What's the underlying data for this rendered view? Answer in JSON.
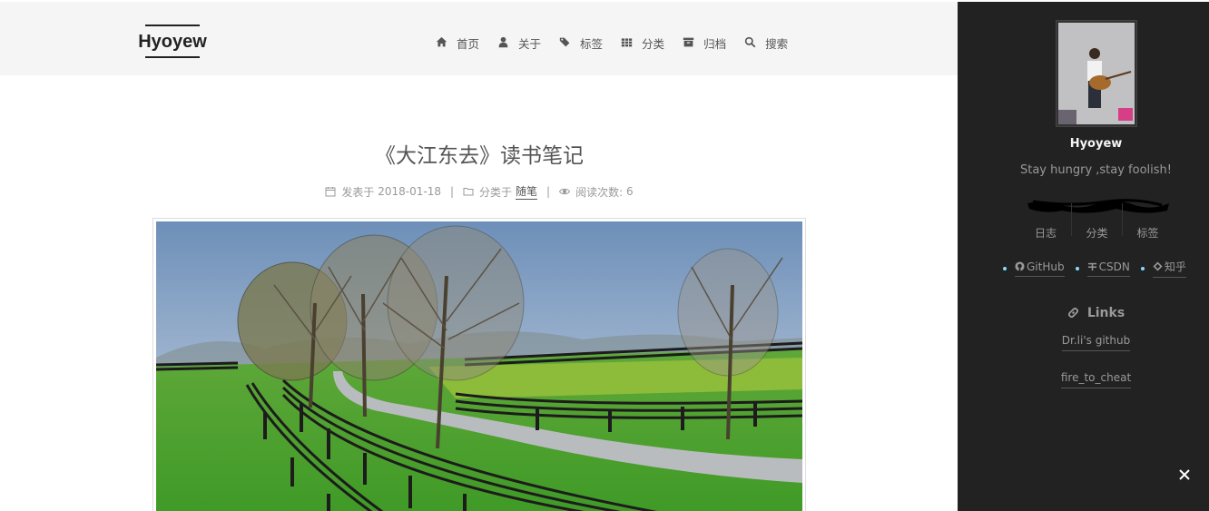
{
  "header": {
    "brand": "Hyoyew",
    "menu": [
      {
        "label": "首页",
        "icon": "home-icon"
      },
      {
        "label": "关于",
        "icon": "user-icon"
      },
      {
        "label": "标签",
        "icon": "tags-icon"
      },
      {
        "label": "分类",
        "icon": "th-icon"
      },
      {
        "label": "归档",
        "icon": "archive-icon"
      },
      {
        "label": "搜索",
        "icon": "search-icon"
      }
    ]
  },
  "post": {
    "title": "《大江东去》读书笔记",
    "published_label": "发表于",
    "published_date": "2018-01-18",
    "category_label": "分类于",
    "category": "随笔",
    "views_label": "阅读次数:",
    "views": "6"
  },
  "sidebar": {
    "author_name": "Hyoyew",
    "author_description": "Stay hungry ,stay foolish!",
    "state": [
      {
        "label": "日志"
      },
      {
        "label": "分类"
      },
      {
        "label": "标签"
      }
    ],
    "social": [
      {
        "label": "GitHub",
        "icon": "github-icon"
      },
      {
        "label": "CSDN",
        "icon": "csdn-icon"
      },
      {
        "label": "知乎",
        "icon": "zhihu-icon"
      }
    ],
    "links_title": "Links",
    "links": [
      "Dr.li's github",
      "fire_to_cheat"
    ]
  },
  "colors": {
    "header_bg": "#f5f5f5",
    "sidebar_bg": "#222222",
    "social_dot": "#87daff"
  }
}
